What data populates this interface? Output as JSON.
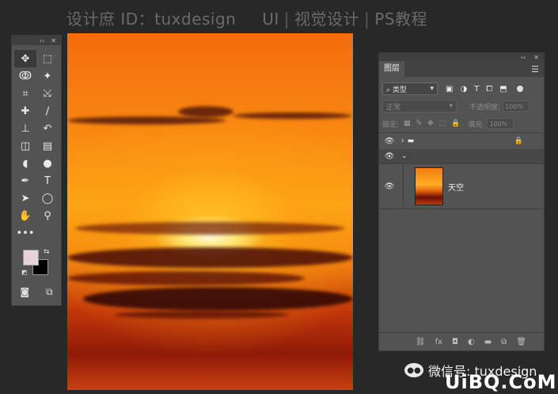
{
  "watermark": {
    "left": "设计庶 ID：tuxdesign",
    "right_a": "UI",
    "right_b": "视觉设计",
    "right_c": "PS教程"
  },
  "tools_panel": {
    "collapse": "‹‹",
    "close": "✕",
    "tools": [
      {
        "name": "move-tool",
        "glyph": "✥",
        "selected": true
      },
      {
        "name": "marquee-tool",
        "glyph": "⬚"
      },
      {
        "name": "lasso-tool",
        "glyph": "ↂ"
      },
      {
        "name": "magic-wand-tool",
        "glyph": "✦"
      },
      {
        "name": "crop-tool",
        "glyph": "⌗"
      },
      {
        "name": "eyedropper-tool",
        "glyph": "⤩"
      },
      {
        "name": "healing-brush-tool",
        "glyph": "✚"
      },
      {
        "name": "brush-tool",
        "glyph": "∕"
      },
      {
        "name": "clone-stamp-tool",
        "glyph": "⊥"
      },
      {
        "name": "history-brush-tool",
        "glyph": "↶"
      },
      {
        "name": "eraser-tool",
        "glyph": "◫"
      },
      {
        "name": "gradient-tool",
        "glyph": "▤"
      },
      {
        "name": "blur-tool",
        "glyph": "◖"
      },
      {
        "name": "dodge-tool",
        "glyph": "●"
      },
      {
        "name": "pen-tool",
        "glyph": "✒"
      },
      {
        "name": "type-tool",
        "glyph": "T"
      },
      {
        "name": "path-selection-tool",
        "glyph": "➤"
      },
      {
        "name": "ellipse-tool",
        "glyph": "◯"
      },
      {
        "name": "hand-tool",
        "glyph": "✋"
      },
      {
        "name": "zoom-tool",
        "glyph": "⚲"
      },
      {
        "name": "more-tools",
        "glyph": "•••"
      },
      {
        "name": "empty",
        "glyph": ""
      }
    ],
    "fg_color": "#e8d4d7",
    "bg_color": "#000000",
    "swap": "⇆",
    "reset": "◩",
    "quick_mask": "◙",
    "screen_mode": "⧉"
  },
  "layers_panel": {
    "collapse": "‹‹",
    "close": "✕",
    "tab": "图层",
    "menu": "☰",
    "filter_label": "⌕ 类型",
    "filter_arrow": "▾",
    "filter_icons": [
      "▣",
      "◑",
      "T",
      "⧠",
      "⬒"
    ],
    "blend_mode": "正常",
    "blend_arrow": "▾",
    "opacity_label": "不透明度:",
    "opacity_value": "100%",
    "lock_label": "锁定:",
    "lock_icons": [
      "▦",
      "✎",
      "✥",
      "⬚",
      "🔒"
    ],
    "fill_label": "填充:",
    "fill_value": "100%",
    "group1": {
      "eye": "👁",
      "arrow": "›",
      "folder": "▬",
      "lock": "🔒"
    },
    "group2": {
      "eye": "👁",
      "arrow": "⌄"
    },
    "layer": {
      "eye": "👁",
      "name": "天空"
    },
    "footer_icons": [
      "⛓",
      "fx",
      "◘",
      "◐",
      "▬",
      "⧉",
      "🗑"
    ]
  },
  "wechat": {
    "label": "微信号: tuxdesign",
    "icon": "wechat-icon"
  },
  "brand": "UiBQ.CoM"
}
